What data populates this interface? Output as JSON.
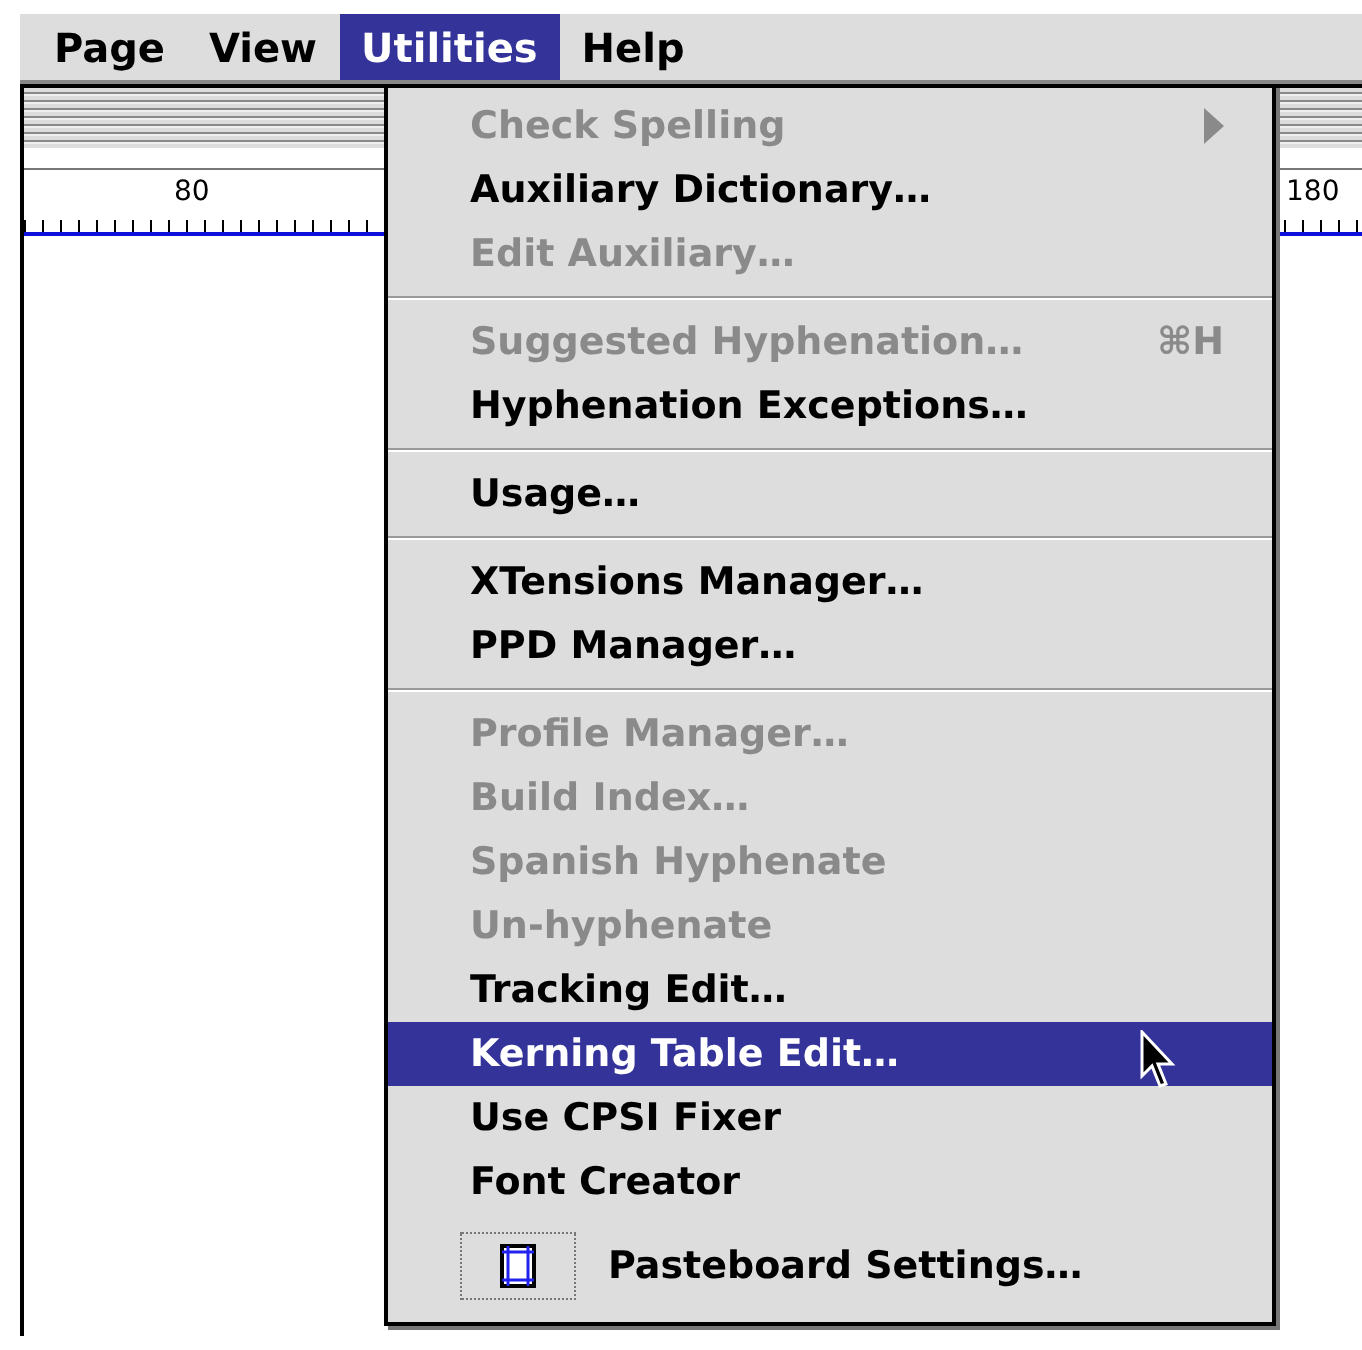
{
  "menubar": [
    {
      "label": "Page",
      "selected": false
    },
    {
      "label": "View",
      "selected": false
    },
    {
      "label": "Utilities",
      "selected": true
    },
    {
      "label": "Help",
      "selected": false
    }
  ],
  "document": {
    "ruler_labels": [
      "80",
      "180"
    ]
  },
  "menu": {
    "items": [
      {
        "kind": "item",
        "label": "Check Spelling",
        "disabled": true,
        "submenu": true,
        "selected": false
      },
      {
        "kind": "item",
        "label": "Auxiliary Dictionary…",
        "disabled": false,
        "selected": false
      },
      {
        "kind": "item",
        "label": "Edit Auxiliary…",
        "disabled": true,
        "selected": false
      },
      {
        "kind": "separator"
      },
      {
        "kind": "item",
        "label": "Suggested Hyphenation…",
        "shortcut": "⌘H",
        "disabled": true,
        "selected": false
      },
      {
        "kind": "item",
        "label": "Hyphenation Exceptions…",
        "disabled": false,
        "selected": false
      },
      {
        "kind": "separator"
      },
      {
        "kind": "item",
        "label": "Usage…",
        "disabled": false,
        "selected": false
      },
      {
        "kind": "separator"
      },
      {
        "kind": "item",
        "label": "XTensions Manager…",
        "disabled": false,
        "selected": false
      },
      {
        "kind": "item",
        "label": "PPD Manager…",
        "disabled": false,
        "selected": false
      },
      {
        "kind": "separator"
      },
      {
        "kind": "item",
        "label": "Profile Manager…",
        "disabled": true,
        "selected": false
      },
      {
        "kind": "item",
        "label": "Build Index…",
        "disabled": true,
        "selected": false
      },
      {
        "kind": "item",
        "label": "Spanish Hyphenate",
        "disabled": true,
        "selected": false
      },
      {
        "kind": "item",
        "label": "Un-hyphenate",
        "disabled": true,
        "selected": false
      },
      {
        "kind": "item",
        "label": "Tracking Edit…",
        "disabled": false,
        "selected": false
      },
      {
        "kind": "item",
        "label": "Kerning Table Edit…",
        "disabled": false,
        "selected": true
      },
      {
        "kind": "item",
        "label": "Use CPSI Fixer",
        "disabled": false,
        "selected": false
      },
      {
        "kind": "item",
        "label": "Font Creator",
        "disabled": false,
        "selected": false
      },
      {
        "kind": "icon_item",
        "label": "Pasteboard Settings…",
        "disabled": false,
        "selected": false
      }
    ]
  }
}
